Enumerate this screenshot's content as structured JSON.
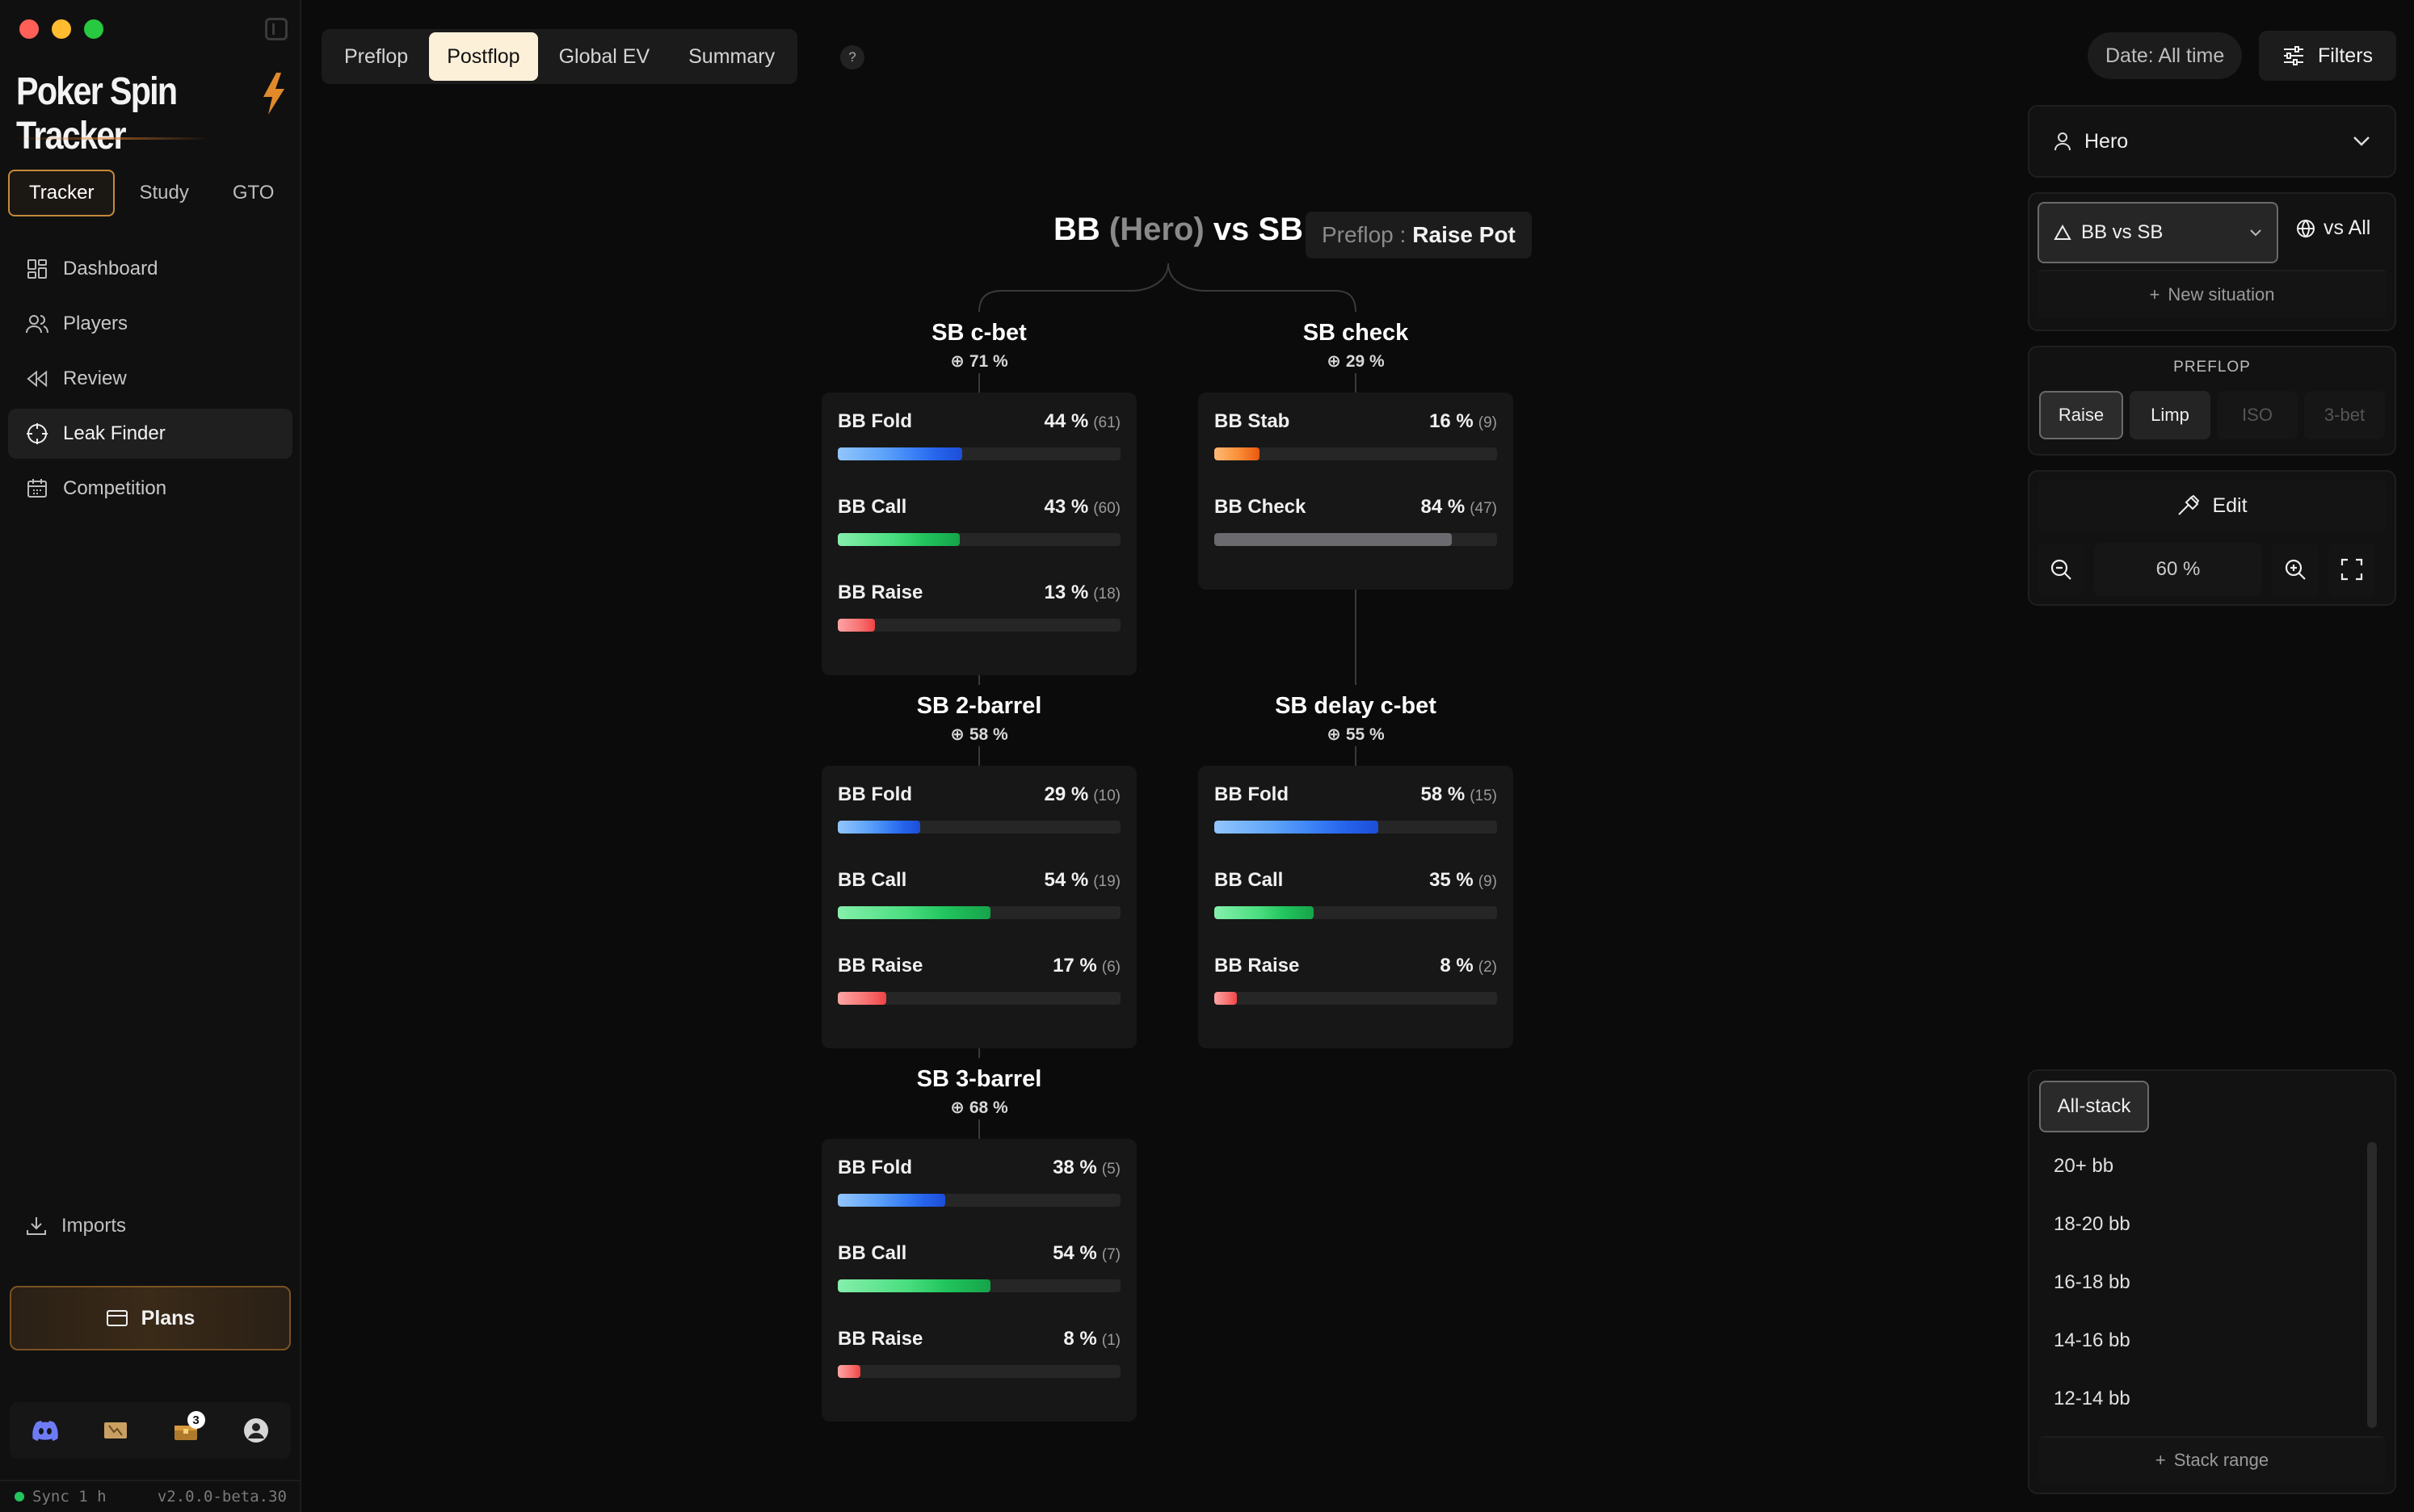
{
  "app": {
    "logo_text": "Poker Spin Tracker",
    "sidebar_tabs": [
      {
        "label": "Tracker",
        "active": true
      },
      {
        "label": "Study",
        "active": false
      },
      {
        "label": "GTO",
        "active": false
      }
    ],
    "nav": [
      {
        "label": "Dashboard",
        "icon": "dashboard-icon",
        "active": false
      },
      {
        "label": "Players",
        "icon": "users-icon",
        "active": false
      },
      {
        "label": "Review",
        "icon": "rewind-icon",
        "active": false
      },
      {
        "label": "Leak Finder",
        "icon": "target-icon",
        "active": true
      },
      {
        "label": "Competition",
        "icon": "calendar-icon",
        "active": false
      }
    ],
    "imports_label": "Imports",
    "plans_label": "Plans",
    "notification_count": "3",
    "sync_label": "Sync 1 h",
    "version": "v2.0.0-beta.30"
  },
  "top_tabs": [
    {
      "label": "Preflop",
      "active": false
    },
    {
      "label": "Postflop",
      "active": true
    },
    {
      "label": "Global EV",
      "active": false
    },
    {
      "label": "Summary",
      "active": false
    }
  ],
  "help_label": "?",
  "date_filter": "Date: All time",
  "filters_label": "Filters",
  "tree": {
    "title_a": "BB",
    "title_hero": "(Hero)",
    "title_b": "vs SB",
    "pot_prefix": "Preflop :",
    "pot_value": "Raise Pot",
    "nodes": {
      "cbet": {
        "name": "SB c-bet",
        "pct": "71 %"
      },
      "check": {
        "name": "SB check",
        "pct": "29 %"
      },
      "barrel2": {
        "name": "SB 2-barrel",
        "pct": "58 %"
      },
      "delay": {
        "name": "SB delay c-bet",
        "pct": "55 %"
      },
      "barrel3": {
        "name": "SB 3-barrel",
        "pct": "68 %"
      }
    },
    "cards": {
      "cbet": [
        {
          "label": "BB Fold",
          "pct": "44 %",
          "cnt": "(61)",
          "value": 44,
          "color": "blue"
        },
        {
          "label": "BB Call",
          "pct": "43 %",
          "cnt": "(60)",
          "value": 43,
          "color": "green"
        },
        {
          "label": "BB Raise",
          "pct": "13 %",
          "cnt": "(18)",
          "value": 13,
          "color": "red"
        }
      ],
      "check": [
        {
          "label": "BB Stab",
          "pct": "16 %",
          "cnt": "(9)",
          "value": 16,
          "color": "orange"
        },
        {
          "label": "BB Check",
          "pct": "84 %",
          "cnt": "(47)",
          "value": 84,
          "color": "gray"
        }
      ],
      "barrel2": [
        {
          "label": "BB Fold",
          "pct": "29 %",
          "cnt": "(10)",
          "value": 29,
          "color": "blue"
        },
        {
          "label": "BB Call",
          "pct": "54 %",
          "cnt": "(19)",
          "value": 54,
          "color": "green"
        },
        {
          "label": "BB Raise",
          "pct": "17 %",
          "cnt": "(6)",
          "value": 17,
          "color": "red"
        }
      ],
      "delay": [
        {
          "label": "BB Fold",
          "pct": "58 %",
          "cnt": "(15)",
          "value": 58,
          "color": "blue"
        },
        {
          "label": "BB Call",
          "pct": "35 %",
          "cnt": "(9)",
          "value": 35,
          "color": "green"
        },
        {
          "label": "BB Raise",
          "pct": "8 %",
          "cnt": "(2)",
          "value": 8,
          "color": "red"
        }
      ],
      "barrel3": [
        {
          "label": "BB Fold",
          "pct": "38 %",
          "cnt": "(5)",
          "value": 38,
          "color": "blue"
        },
        {
          "label": "BB Call",
          "pct": "54 %",
          "cnt": "(7)",
          "value": 54,
          "color": "green"
        },
        {
          "label": "BB Raise",
          "pct": "8 %",
          "cnt": "(1)",
          "value": 8,
          "color": "red"
        }
      ]
    }
  },
  "right": {
    "player_select": "Hero",
    "situation": "BB vs SB",
    "vs_all": "vs All",
    "new_situation": "New situation",
    "preflop_title": "PREFLOP",
    "preflop_options": [
      {
        "label": "Raise",
        "state": "selected"
      },
      {
        "label": "Limp",
        "state": "enabled"
      },
      {
        "label": "ISO",
        "state": "disabled"
      },
      {
        "label": "3-bet",
        "state": "disabled"
      }
    ],
    "edit_label": "Edit",
    "zoom": "60 %",
    "stack_selected": "All-stack",
    "stacks": [
      "20+ bb",
      "18-20 bb",
      "16-18 bb",
      "14-16 bb",
      "12-14 bb"
    ],
    "stack_add": "Stack range"
  },
  "colors": {
    "accent": "#c58a3b",
    "active_tab": "#fdf0d8",
    "blue": "#3b82f6",
    "green": "#22c55e",
    "red": "#f87171",
    "orange": "#fb923c",
    "gray": "#6b6b6f"
  }
}
